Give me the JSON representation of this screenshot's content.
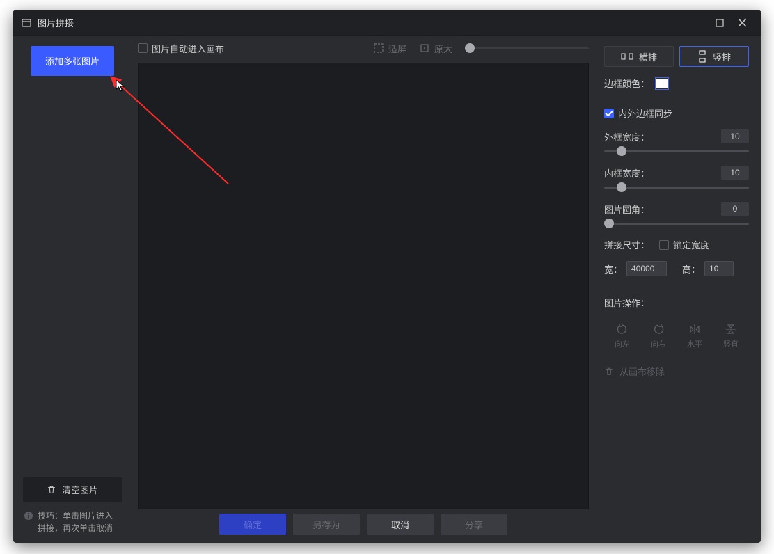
{
  "title": "图片拼接",
  "left": {
    "add_button": "添加多张图片",
    "clear_button": "清空图片",
    "tip_prefix": "技巧：",
    "tip_text": "单击图片进入拼接，再次单击取消"
  },
  "toolbar": {
    "auto_fit_label": "图片自动进入画布",
    "fit_label": "适屏",
    "actual_label": "原大"
  },
  "tabs": {
    "horizontal": "横排",
    "vertical": "竖排"
  },
  "right": {
    "border_color_label": "边框颜色：",
    "sync_label": "内外边框同步",
    "outer_label": "外框宽度：",
    "outer_value": "10",
    "inner_label": "内框宽度：",
    "inner_value": "10",
    "radius_label": "图片圆角：",
    "radius_value": "0",
    "size_label": "拼接尺寸：",
    "lock_width_label": "锁定宽度",
    "width_label": "宽：",
    "width_value": "40000",
    "height_label": "高：",
    "height_value": "10",
    "ops_label": "图片操作：",
    "ops": {
      "left": "向左",
      "right": "向右",
      "h": "水平",
      "v": "竖直"
    },
    "remove_label": "从画布移除"
  },
  "bottom": {
    "ok": "确定",
    "save_as": "另存为",
    "cancel": "取消",
    "share": "分享"
  }
}
